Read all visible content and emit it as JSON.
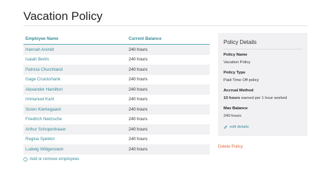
{
  "page": {
    "title": "Vacation Policy"
  },
  "table": {
    "headers": {
      "name": "Employee Name",
      "balance": "Current Balance"
    },
    "rows": [
      {
        "name": "Hannah Arendt",
        "balance": "240 hours"
      },
      {
        "name": "Isaiah Berlin",
        "balance": "240 hours"
      },
      {
        "name": "Patricia Churchland",
        "balance": "240 hours"
      },
      {
        "name": "Gage Cruickshank",
        "balance": "240 hours"
      },
      {
        "name": "Alexander Hamilton",
        "balance": "240 hours"
      },
      {
        "name": "Immanuel Kant",
        "balance": "240 hours"
      },
      {
        "name": "Soren Kierkegaard",
        "balance": "240 hours"
      },
      {
        "name": "Friedrich Nietzsche",
        "balance": "240 hours"
      },
      {
        "name": "Arthur Schopenhauer",
        "balance": "240 hours"
      },
      {
        "name": "Regina Spektor",
        "balance": "240 hours"
      },
      {
        "name": "Ludwig Wittgenstein",
        "balance": "240 hours"
      }
    ],
    "add_label": "Add or remove employees"
  },
  "details": {
    "title": "Policy Details",
    "policy_name_label": "Policy Name",
    "policy_name_value": "Vacation Policy",
    "policy_type_label": "Policy Type",
    "policy_type_value": "Paid Time Off policy",
    "accrual_label": "Accrual Method",
    "accrual_amount": "10 hours",
    "accrual_rest": " earned per 1 hour worked",
    "max_label": "Max Balance",
    "max_value": "240 hours",
    "edit_label": "edit details"
  },
  "actions": {
    "delete_label": "Delete Policy"
  },
  "colors": {
    "accent": "#3a8b99",
    "danger": "#e06a3b",
    "panel": "#f1f1f3"
  },
  "icons": {
    "add": "plus-circle-icon",
    "edit": "pencil-icon"
  }
}
